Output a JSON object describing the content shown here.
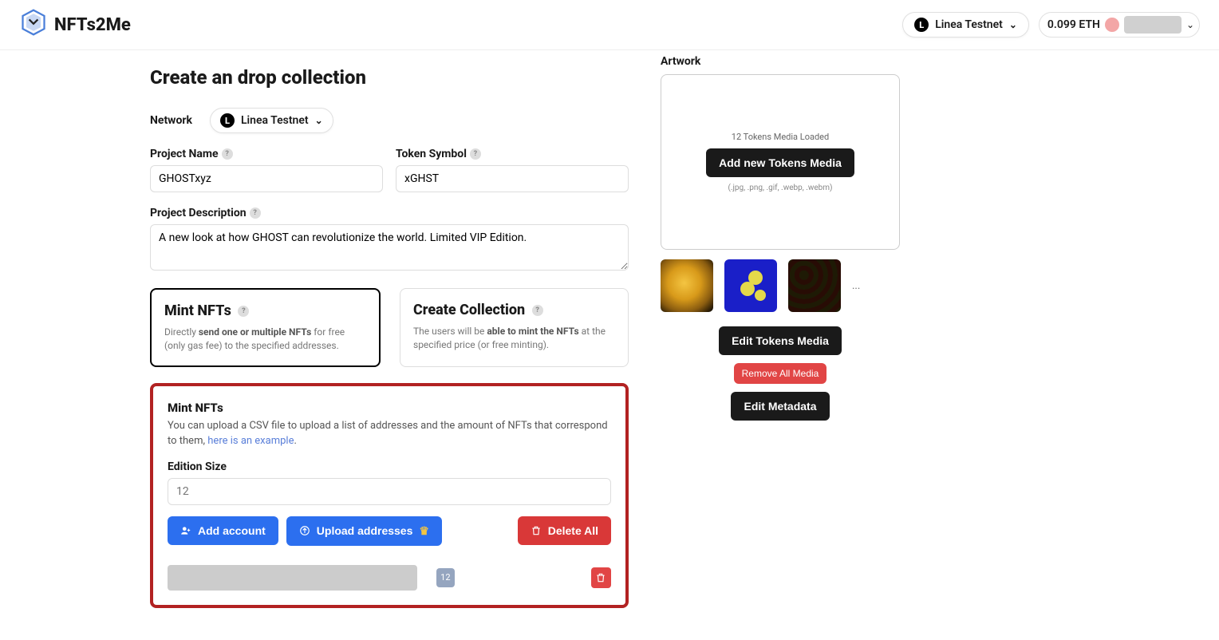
{
  "header": {
    "brand": "NFTs2Me",
    "network_label": "Linea Testnet",
    "eth_balance": "0.099 ETH"
  },
  "page": {
    "title": "Create an drop collection",
    "network_label_field": "Network",
    "network_value": "Linea Testnet",
    "project_name_label": "Project Name",
    "project_name_value": "GHOSTxyz",
    "token_symbol_label": "Token Symbol",
    "token_symbol_value": "xGHST",
    "description_label": "Project Description",
    "description_value": "A new look at how GHOST can revolutionize the world. Limited VIP Edition."
  },
  "options": {
    "mint": {
      "title": "Mint NFTs",
      "desc_pre": "Directly ",
      "desc_bold": "send one or multiple NFTs",
      "desc_post": " for free (only gas fee) to the specified addresses."
    },
    "collection": {
      "title": "Create Collection",
      "desc_pre": "The users will be ",
      "desc_bold": "able to mint the NFTs",
      "desc_post": " at the specified price (or free minting)."
    }
  },
  "mint_panel": {
    "title": "Mint NFTs",
    "desc_pre": "You can upload a CSV file to upload a list of addresses and the amount of NFTs that correspond to them, ",
    "link": "here is an example",
    "edition_label": "Edition Size",
    "edition_placeholder": "12",
    "add_account": "Add account",
    "upload_addresses": "Upload addresses",
    "delete_all": "Delete All",
    "row_count": "12"
  },
  "artwork": {
    "label": "Artwork",
    "tokens_loaded": "12 Tokens Media Loaded",
    "add_button": "Add new Tokens Media",
    "formats": "(.jpg, .png, .gif, .webp, .webm)",
    "more": "...",
    "edit_media": "Edit Tokens Media",
    "remove_all": "Remove All Media",
    "edit_metadata": "Edit Metadata"
  }
}
